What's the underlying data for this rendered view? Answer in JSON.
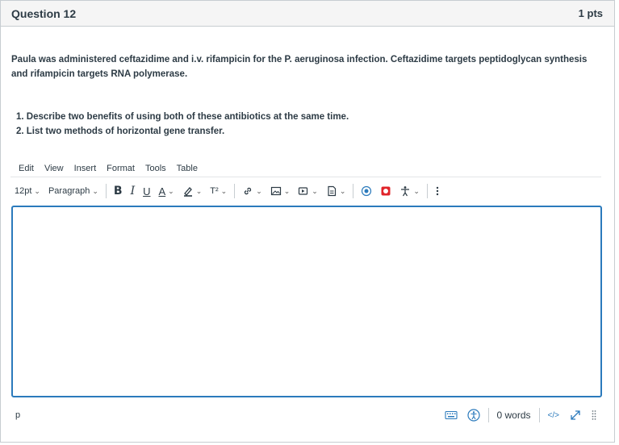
{
  "question": {
    "title": "Question 12",
    "points": "1 pts",
    "text": "Paula was administered ceftazidime and i.v. rifampicin for the P. aeruginosa infection. Ceftazidime targets peptidoglycan synthesis and rifampicin targets RNA polymerase.",
    "items": [
      "1. Describe two benefits of using both of these antibiotics at the same time.",
      "2. List two methods of horizontal gene transfer."
    ]
  },
  "editor": {
    "menu": [
      "Edit",
      "View",
      "Insert",
      "Format",
      "Tools",
      "Table"
    ],
    "toolbar": {
      "font_size": "12pt",
      "block_format": "Paragraph",
      "bold": "B",
      "italic": "I",
      "underline": "U",
      "text_color": "A",
      "superscript": "T²"
    },
    "icons": {
      "highlight": "highlighter-icon",
      "link": "link-icon",
      "image": "image-icon",
      "media": "media-icon",
      "document": "document-icon",
      "record": "record-icon",
      "apps": "apps-icon",
      "accessibility": "accessibility-icon",
      "more": "more-icon",
      "keyboard": "keyboard-icon",
      "fullscreen": "fullscreen-icon",
      "resize": "resize-handle-icon"
    },
    "status": {
      "element_path": "p",
      "word_count": "0 words",
      "html_toggle": "</>"
    },
    "colors": {
      "focus_border": "#2b7abc",
      "record_red": "#e0242a",
      "accent_blue": "#2b7abc"
    }
  }
}
